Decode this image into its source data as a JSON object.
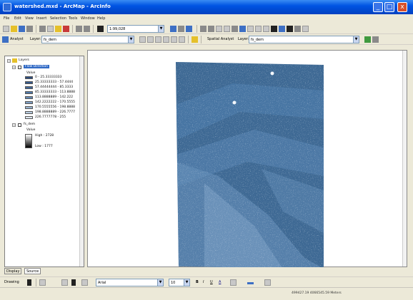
{
  "window": {
    "title": "watershed.mxd - ArcMap - ArcInfo",
    "minimize": "_",
    "maximize": "□",
    "close": "x"
  },
  "menu": [
    "File",
    "Edit",
    "View",
    "Insert",
    "Selection",
    "Tools",
    "Window",
    "Help"
  ],
  "toolbar1": {
    "scale": "1:99,028"
  },
  "toolbar2": {
    "analyst_label": "Analyst",
    "layer_label": "Layer:",
    "layer_value": "fs_dem",
    "spatial_analyst_label": "Spatial Analyst",
    "layer2_label": "Layer:",
    "layer2_value": "fs_dem"
  },
  "toc": {
    "root": "Layers",
    "layer1": {
      "name": "Flow Direction",
      "value_header": "Value",
      "classes": [
        {
          "label": "0 - 25.33333333",
          "color": "#2E4E7E"
        },
        {
          "label": "25.33333333 - 57.4444",
          "color": "#365A8C"
        },
        {
          "label": "57.44444444 - 85.3333",
          "color": "#41689A"
        },
        {
          "label": "85.33333333 - 113.8888",
          "color": "#5079A8"
        },
        {
          "label": "113.8888889 - 142.222",
          "color": "#6489B4"
        },
        {
          "label": "142.2222222 - 170.5555",
          "color": "#7C9DC2"
        },
        {
          "label": "170.5555556 - 198.8888",
          "color": "#97B3D0"
        },
        {
          "label": "198.8888889 - 226.7777",
          "color": "#B6CBDF"
        },
        {
          "label": "226.7777778 - 255",
          "color": "#DCE6F0"
        }
      ]
    },
    "layer2": {
      "name": "fs_dem",
      "value_header": "Value",
      "high": "High : 2728",
      "low": "Low : 1777"
    }
  },
  "toc_tabs": {
    "display": "Display",
    "source": "Source"
  },
  "drawing_toolbar": {
    "drawing_label": "Drawing",
    "font_value": "Arial",
    "size_value": "10",
    "bold": "B",
    "italic": "I",
    "underline": "U",
    "font_color": "A"
  },
  "status": {
    "coordinates": "499427.19  4066545.59 Meters"
  }
}
